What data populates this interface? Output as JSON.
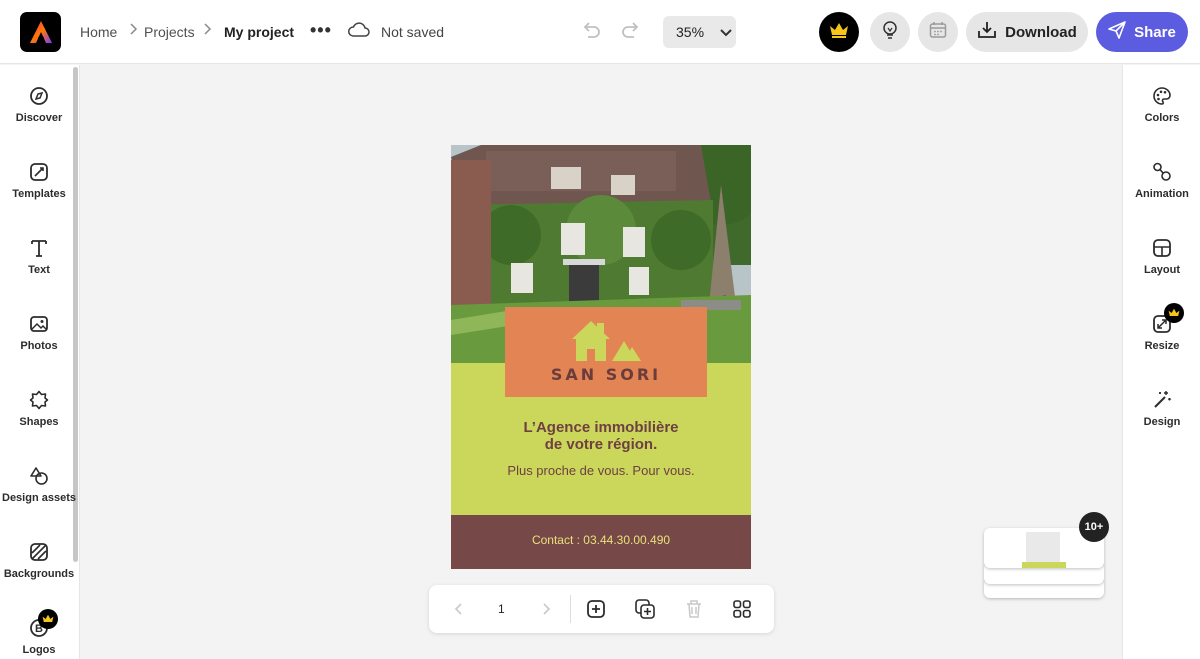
{
  "header": {
    "breadcrumb": [
      "Home",
      "Projects",
      "My project"
    ],
    "more_label": "•••",
    "save_status": "Not saved",
    "zoom": "35%",
    "download_label": "Download",
    "share_label": "Share"
  },
  "left_sidebar": {
    "items": [
      {
        "label": "Discover",
        "icon": "compass-icon"
      },
      {
        "label": "Templates",
        "icon": "templates-icon"
      },
      {
        "label": "Text",
        "icon": "text-icon"
      },
      {
        "label": "Photos",
        "icon": "photos-icon"
      },
      {
        "label": "Shapes",
        "icon": "shapes-icon"
      },
      {
        "label": "Design assets",
        "icon": "design-assets-icon"
      },
      {
        "label": "Backgrounds",
        "icon": "backgrounds-icon"
      },
      {
        "label": "Logos",
        "icon": "logos-icon"
      }
    ]
  },
  "right_sidebar": {
    "items": [
      {
        "label": "Colors",
        "icon": "palette-icon"
      },
      {
        "label": "Animation",
        "icon": "animation-icon"
      },
      {
        "label": "Layout",
        "icon": "layout-icon"
      },
      {
        "label": "Resize",
        "icon": "resize-icon"
      },
      {
        "label": "Design",
        "icon": "magic-wand-icon"
      }
    ]
  },
  "canvas": {
    "brand_name": "SAN SORI",
    "headline_line1": "L’Agence immobilière",
    "headline_line2": "de votre région.",
    "tagline": "Plus proche de vous. Pour vous.",
    "contact": "Contact : 03.44.30.00.490"
  },
  "page_toolbar": {
    "page_number": "1"
  },
  "pages_stack": {
    "count": "10+"
  },
  "colors": {
    "accent": "#5c5ce0",
    "canvas_green": "#cbd75b",
    "logo_orange": "#e28454",
    "footer_brown": "#774848",
    "headline_text": "#6e3f43",
    "contact_text": "#e9e07a",
    "premium_gold": "#f5c518"
  }
}
